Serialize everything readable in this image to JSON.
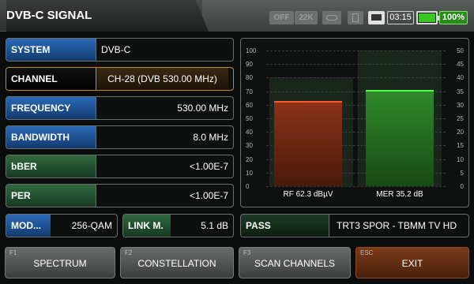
{
  "header": {
    "title": "DVB-C SIGNAL",
    "lnb_off": "OFF",
    "tone": "22K",
    "time": "03:15",
    "battery_percent": "100%",
    "battery_level": 1.0,
    "icons": [
      "antenna-icon",
      "sd-card-icon",
      "monitor-icon",
      "battery-icon"
    ]
  },
  "info": {
    "system": {
      "label": "SYSTEM",
      "value": "DVB-C"
    },
    "channel": {
      "label": "CHANNEL",
      "value": "CH-28 (DVB 530.00 MHz)"
    },
    "frequency": {
      "label": "FREQUENCY",
      "value": "530.00 MHz"
    },
    "bandwidth": {
      "label": "BANDWIDTH",
      "value": "8.0 MHz"
    },
    "bber": {
      "label": "bBER",
      "value": "<1.00E-7"
    },
    "per": {
      "label": "PER",
      "value": "<1.00E-7"
    },
    "modulation": {
      "label": "MOD...",
      "value": "256-QAM"
    },
    "link_margin": {
      "label": "LINK M.",
      "value": "5.1 dB"
    }
  },
  "pass": {
    "label": "PASS",
    "value": "TRT3 SPOR - TBMM TV HD"
  },
  "function_keys": [
    {
      "key": "F1",
      "label": "SPECTRUM"
    },
    {
      "key": "F2",
      "label": "CONSTELLATION"
    },
    {
      "key": "F3",
      "label": "SCAN CHANNELS"
    },
    {
      "key": "ESC",
      "label": "EXIT"
    }
  ],
  "colors": {
    "accent_blue": "#2a6ab8",
    "pass_green": "#39c624",
    "rf_bar": "#7a2a14",
    "mer_bar": "#2f7a2a",
    "selected_border": "#c48a33"
  },
  "chart_data": {
    "type": "bar",
    "categories": [
      "RF",
      "MER"
    ],
    "series": [
      {
        "axis": "left",
        "values": [
          62.3,
          null
        ],
        "label": "RF 62.3 dBµV"
      },
      {
        "axis": "right",
        "values": [
          null,
          35.2
        ],
        "label": "MER 35.2 dB"
      }
    ],
    "y_left": {
      "ticks": [
        0,
        10,
        20,
        30,
        40,
        50,
        60,
        70,
        80,
        90,
        100
      ],
      "range": [
        0,
        100
      ]
    },
    "y_right": {
      "ticks": [
        0,
        5,
        10,
        15,
        20,
        25,
        30,
        35,
        40,
        45,
        50
      ],
      "range": [
        0,
        50
      ]
    },
    "rf_zone_range": [
      0,
      80
    ],
    "mer_zone_range": [
      0,
      50
    ],
    "grid": true
  }
}
